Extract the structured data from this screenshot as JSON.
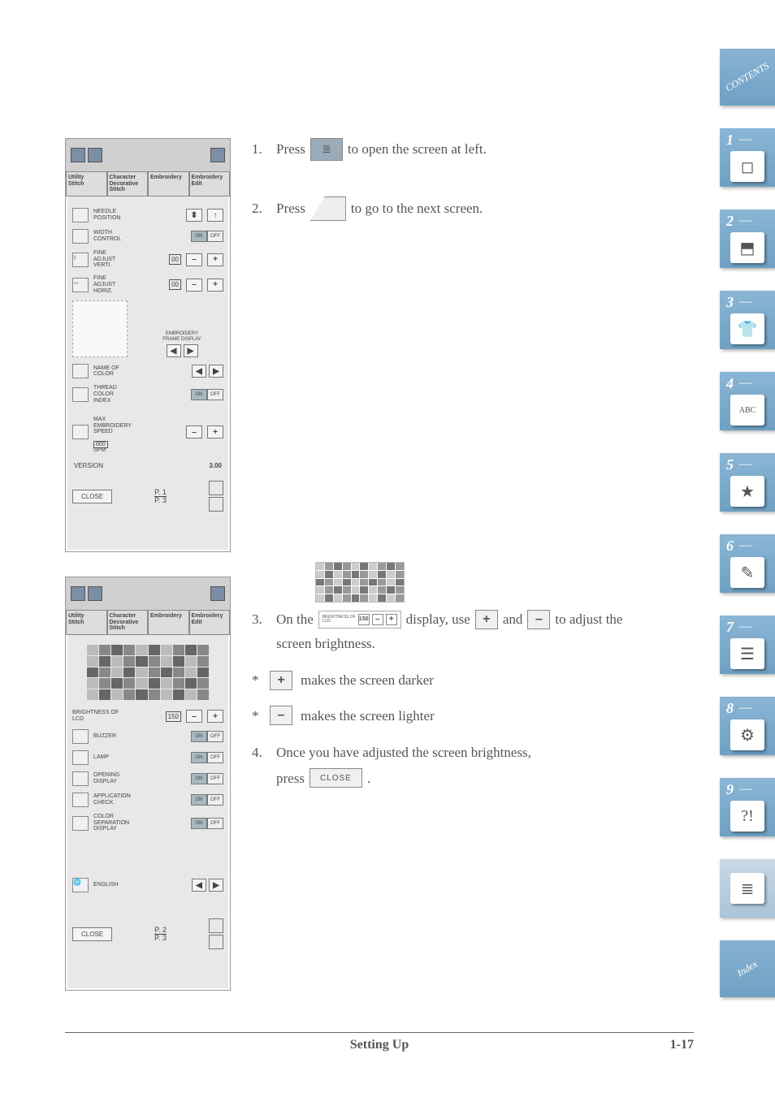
{
  "sideTabs": {
    "contents": "CONTENTS",
    "index": "Index",
    "items": [
      {
        "num": "1",
        "dash": "—",
        "glyph": "◻"
      },
      {
        "num": "2",
        "dash": "—",
        "glyph": "⬒"
      },
      {
        "num": "3",
        "dash": "—",
        "glyph": "👕"
      },
      {
        "num": "4",
        "dash": "—",
        "glyph": "ABC"
      },
      {
        "num": "5",
        "dash": "—",
        "glyph": "★"
      },
      {
        "num": "6",
        "dash": "—",
        "glyph": "✎"
      },
      {
        "num": "7",
        "dash": "—",
        "glyph": "☰"
      },
      {
        "num": "8",
        "dash": "—",
        "glyph": "⚙"
      },
      {
        "num": "9",
        "dash": "—",
        "glyph": "?!"
      }
    ],
    "docTab": {
      "glyph": "≣"
    }
  },
  "screen1": {
    "tabs": [
      "Utility\nStitch",
      "Character\nDecorative\nStitch",
      "Embroidery",
      "Embroidery\nEdit"
    ],
    "rows": {
      "needle": "NEEDLE\nPOSITION",
      "width": "WIDTH\nCONTROL",
      "fineV": "FINE\nADJUST\nVERTI.",
      "fineVVal": "00",
      "fineH": "FINE\nADJUST\nHORIZ.",
      "fineHVal": "00",
      "frame": "EMBROIDERY\nFRAME DISPLAY",
      "nameColor": "NAME OF\nCOLOR",
      "threadIdx": "THREAD\nCOLOR\nINDEX",
      "embSpeed": "MAX\nEMBROIDERY\nSPEED",
      "spm": "SPM",
      "spmVal": "800"
    },
    "on": "ON",
    "off": "OFF",
    "version": {
      "label": "VERSION",
      "value": "3.00"
    },
    "close": "CLOSE",
    "page": {
      "top": "P. 1",
      "bottom": "P. 3"
    }
  },
  "screen2": {
    "tabs": [
      "Utility\nStitch",
      "Character\nDecorative\nStitch",
      "Embroidery",
      "Embroidery\nEdit"
    ],
    "rows": {
      "brightness": "BRIGHTNESS OF\nLCD",
      "brightnessVal": "150",
      "buzzer": "BUZZER",
      "lamp": "LAMP",
      "opening": "OPENING\nDISPLAY",
      "appCheck": "APPLICATION\nCHECK",
      "colorSep": "COLOR\nSEPARATION\nDISPLAY",
      "language": "ENGLISH"
    },
    "on": "ON",
    "off": "OFF",
    "close": "CLOSE",
    "page": {
      "top": "P. 2",
      "bottom": "P. 3"
    }
  },
  "steps": {
    "s1a": "1.",
    "s1b": "Press",
    "s1c": "to open the screen at left.",
    "s2a": "2.",
    "s2b": "Press",
    "s2c": "to go to the next screen.",
    "s3a": "3.",
    "s3b": "On the",
    "s3c": "display, use",
    "s3d": "and",
    "s3e": "to adjust the",
    "s3f": "screen brightness.",
    "b1": "makes the screen darker",
    "b2": "makes the screen lighter",
    "s4a": "4.",
    "s4b": "Once you have adjusted the screen brightness,",
    "s4c": "press",
    "s4d": ".",
    "brightLabel": "BRIGHTNESS OF\nLCD",
    "brightVal": "150",
    "plus": "+",
    "minus": "–",
    "close": "CLOSE"
  },
  "footer": {
    "title": "Setting Up",
    "page": "1-17"
  }
}
